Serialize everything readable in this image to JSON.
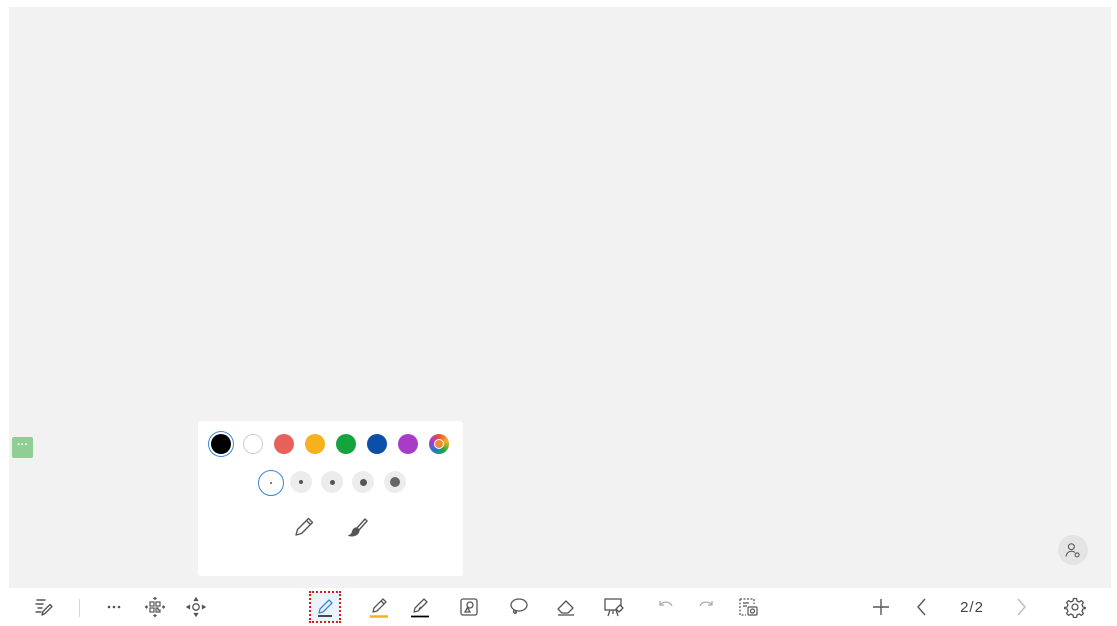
{
  "toolbar": {
    "page_indicator": "2/2"
  },
  "pen_panel": {
    "colors": [
      {
        "name": "black",
        "hex": "#000000"
      },
      {
        "name": "white",
        "hex": "#ffffff"
      },
      {
        "name": "red",
        "hex": "#e8605a"
      },
      {
        "name": "yellow",
        "hex": "#f5b21d"
      },
      {
        "name": "green",
        "hex": "#14a33c"
      },
      {
        "name": "blue",
        "hex": "#0b4fa8"
      },
      {
        "name": "purple",
        "hex": "#a83cc9"
      },
      {
        "name": "custom",
        "hex": "multicolor"
      }
    ],
    "selected_color": "black",
    "stroke_sizes": [
      "xs",
      "s",
      "m",
      "l",
      "xl"
    ],
    "selected_size": "xs",
    "pen_types": [
      "pencil-icon",
      "brush-icon"
    ]
  },
  "accent": "#3a86d8",
  "icons": [
    "notes-edit-icon",
    "more-icon",
    "qr-code-icon",
    "move-icon",
    "pen-icon",
    "highlighter-icon",
    "marker-icon",
    "shape-recognition-icon",
    "lasso-icon",
    "eraser-icon",
    "presentation-icon",
    "undo-icon",
    "redo-icon",
    "screenshot-icon",
    "add-page-icon",
    "previous-page-icon",
    "next-page-icon",
    "settings-icon",
    "user-icon"
  ]
}
